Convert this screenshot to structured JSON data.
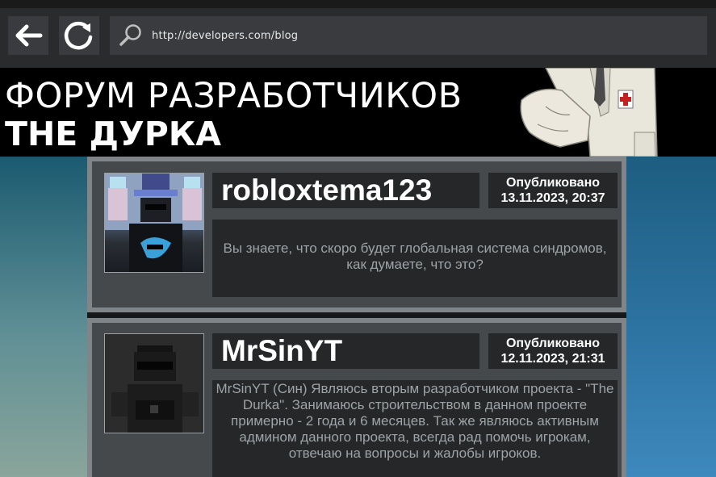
{
  "browser": {
    "back_icon": "back-arrow-icon",
    "reload_icon": "reload-icon",
    "search_icon": "search-icon",
    "url": "http://developers.com/blog"
  },
  "banner": {
    "title_line1": "ФОРУМ РАЗРАБОТЧИКОВ",
    "title_line2": "THE ДУРКА"
  },
  "posts": [
    {
      "username": "robloxtema123",
      "published_label": "Опубликовано",
      "published_at": "13.11.2023, 20:37",
      "message": "Вы знаете,  что скоро будет глобальная система синдромов, как думаете, что это?"
    },
    {
      "username": "MrSinYT",
      "published_label": "Опубликовано",
      "published_at": "12.11.2023, 21:31",
      "message": "MrSinYT (Син) Являюсь вторым разработчиком проекта - \"The Durka\". Занимаюсь строительством в данном проекте примерно - 2 года и 6 месяцев. Так же являюсь активным админом данного проекта, всегда рад помочь игрокам, отвечаю на вопросы и жалобы игроков."
    }
  ],
  "colors": {
    "chrome_bg": "#2a2b2d",
    "button_bg": "#3a3b3e",
    "banner_bg": "#000000",
    "post_frame": "#7f8588",
    "post_bg": "#45494b",
    "box_bg": "#252729",
    "message_text": "#9ea3a6"
  }
}
